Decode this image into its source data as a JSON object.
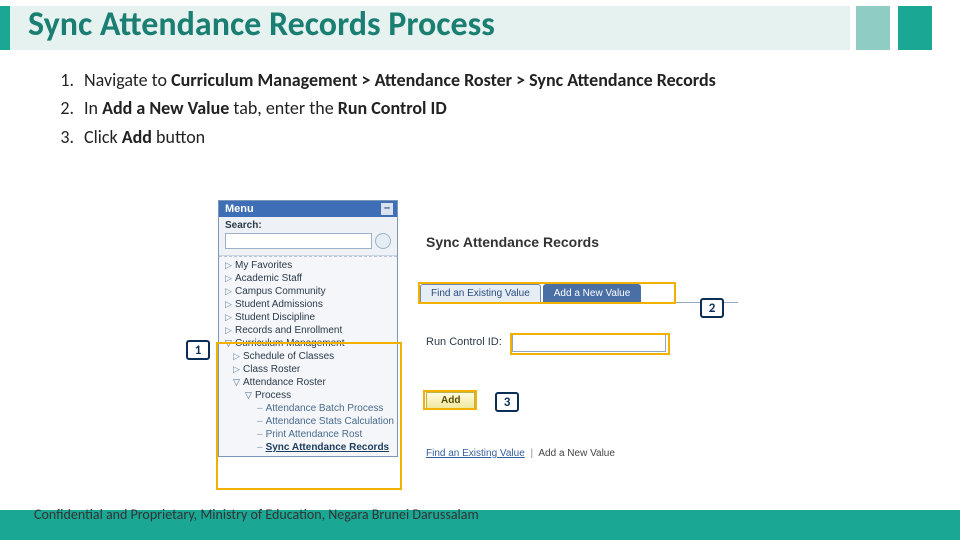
{
  "title": "Sync Attendance Records Process",
  "instructions": [
    {
      "num": "1.",
      "pre": "Navigate to ",
      "bold": "Curriculum Management > Attendance Roster > Sync Attendance Records",
      "post": ""
    },
    {
      "num": "2.",
      "pre": "In ",
      "bold": "Add a New Value",
      "post_a": " tab, enter the ",
      "bold_b": "Run Control ID",
      "post_b": ""
    },
    {
      "num": "3.",
      "pre": "Click ",
      "bold": "Add",
      "post": " button"
    }
  ],
  "menu": {
    "title": "Menu",
    "search_label": "Search:",
    "items_collapsed": [
      "My Favorites",
      "Academic Staff",
      "Campus Community",
      "Student Admissions",
      "Student Discipline",
      "Records and Enrollment"
    ],
    "expanded": {
      "root": "Curriculum Management",
      "children_simple": [
        "Schedule of Classes",
        "Class Roster"
      ],
      "attendance": {
        "label": "Attendance Roster",
        "process": {
          "label": "Process",
          "links": [
            "Attendance Batch Process",
            "Attendance Stats Calculation",
            "Print Attendance Rost",
            "Sync Attendance Records"
          ]
        }
      }
    }
  },
  "panel": {
    "heading": "Sync Attendance Records",
    "tabs": {
      "inactive": "Find an Existing Value",
      "active": "Add a New Value"
    },
    "field_label": "Run Control ID:",
    "add_button": "Add",
    "bottom_links": {
      "link": "Find an Existing Value",
      "plain": "Add a New Value"
    }
  },
  "callouts": {
    "c1": "1",
    "c2": "2",
    "c3": "3"
  },
  "footer": "Confidential and Proprietary, Ministry of Education, Negara Brunei Darussalam"
}
